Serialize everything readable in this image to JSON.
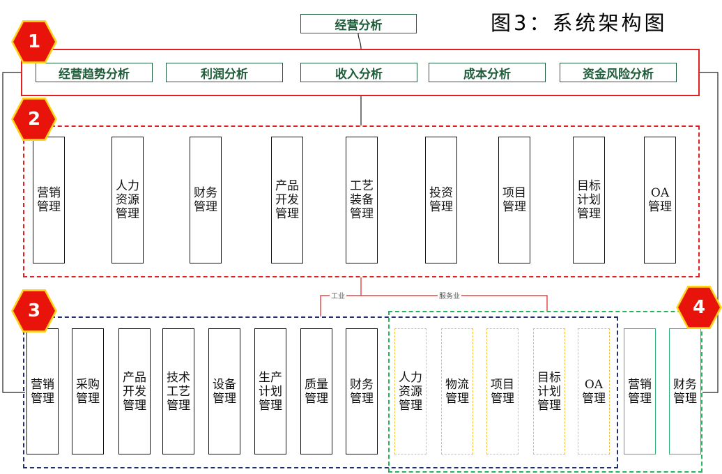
{
  "title": "图3：系统架构图",
  "top_node": "经营分析",
  "badges": [
    "1",
    "2",
    "3",
    "4"
  ],
  "layer1": [
    "经营趋势分析",
    "利润分析",
    "收入分析",
    "成本分析",
    "资金风险分析"
  ],
  "layer2": [
    "营销管理",
    "人力资源管理",
    "财务管理",
    "产品开发管理",
    "工艺装备管理",
    "投资管理",
    "项目管理",
    "目标计划管理",
    "OA管理"
  ],
  "branch_labels": {
    "industry": "工业",
    "service": "服务业"
  },
  "layer3_industry": [
    "营销管理",
    "采购管理",
    "产品开发管理",
    "技术工艺管理",
    "设备管理",
    "生产计划管理",
    "质量管理",
    "财务管理"
  ],
  "layer3_shared": [
    "人力资源管理",
    "物流管理",
    "项目管理",
    "目标计划管理",
    "OA管理"
  ],
  "layer3_service": [
    "营销管理",
    "财务管理"
  ],
  "colors": {
    "red": "#e02020",
    "blue": "#1f2e6e",
    "green": "#22b55a",
    "yellow": "#f2c12e",
    "dark_green_text": "#1e5c3a"
  }
}
